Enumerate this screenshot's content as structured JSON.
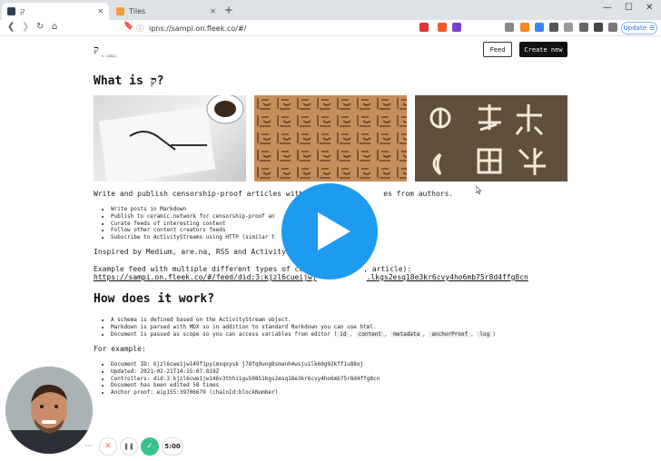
{
  "browser": {
    "tabs": [
      {
        "title": "ק",
        "active": true
      },
      {
        "title": "Tiles",
        "active": false
      }
    ],
    "new_tab": "+",
    "window_controls": [
      "—",
      "☐",
      "✕"
    ],
    "address": "ipns://sampi.on.fleek.co/#/",
    "update_label": "Update"
  },
  "page": {
    "logo": "ק",
    "logo_sub": "א sampi",
    "feed_label": "Feed",
    "create_label": "Create new",
    "heading1": "What is ק?",
    "intro": "Write and publish censorship-proof articles with",
    "intro_tail": "es from authors.",
    "features": [
      "Write posts in Markdown",
      "Publish to ceramic.network for censorship-proof an",
      "Curate feeds of interesting content",
      "Follow other content creators feeds",
      "Subscribe to ActivityStreams using HTTP (similar t"
    ],
    "inspired": "Inspired by Medium, are.na, RSS and ActivitySt",
    "example_label": "Example feed with multiple different types of co",
    "example_label_tail": ", article):",
    "example_link": "https://sampi.on.fleek.co/#/feed/did:3:kjzl6cueijwj",
    "example_link_tail": ".lkgs2esq18e3kr6cvy4ho6mb75r8d4ffg8cn",
    "heading2": "How does it work?",
    "how": [
      "A schema is defined based on the ActivityStream object.",
      "Markdown is parsed with MDX so in addition to standard Markdown you can use html.",
      "Document is passed as scope so you can access variables from editor ("
    ],
    "scope_vars": [
      "id",
      "content",
      "metadata",
      "anchorProof",
      "log"
    ],
    "for_example": "For example:",
    "example_items": [
      "Document ID: kjzl6cwe1jw149f1pyimxqxysk j78fq9ung8smanh4wsju1lk60g92kff1u88oj",
      "Updated: 2021-02-21T14:15:07.819Z",
      "Controllers: did:3:kjzl6cwe1jw146v3thhi1gu50851kgs2esq18e3kr6cvy4ho6mb75r8d4ffg8cn",
      "Document has been edited 58 times",
      "Anchor proof: eip155:39706679 (chainId:blockNumber)"
    ]
  },
  "recorder": {
    "more": "···",
    "cancel": "✕",
    "pause": "❚❚",
    "done": "✓",
    "timer": "5:00"
  },
  "colors": {
    "play": "#1d9bf0",
    "done": "#3ac18e",
    "cancel": "#e57373"
  }
}
